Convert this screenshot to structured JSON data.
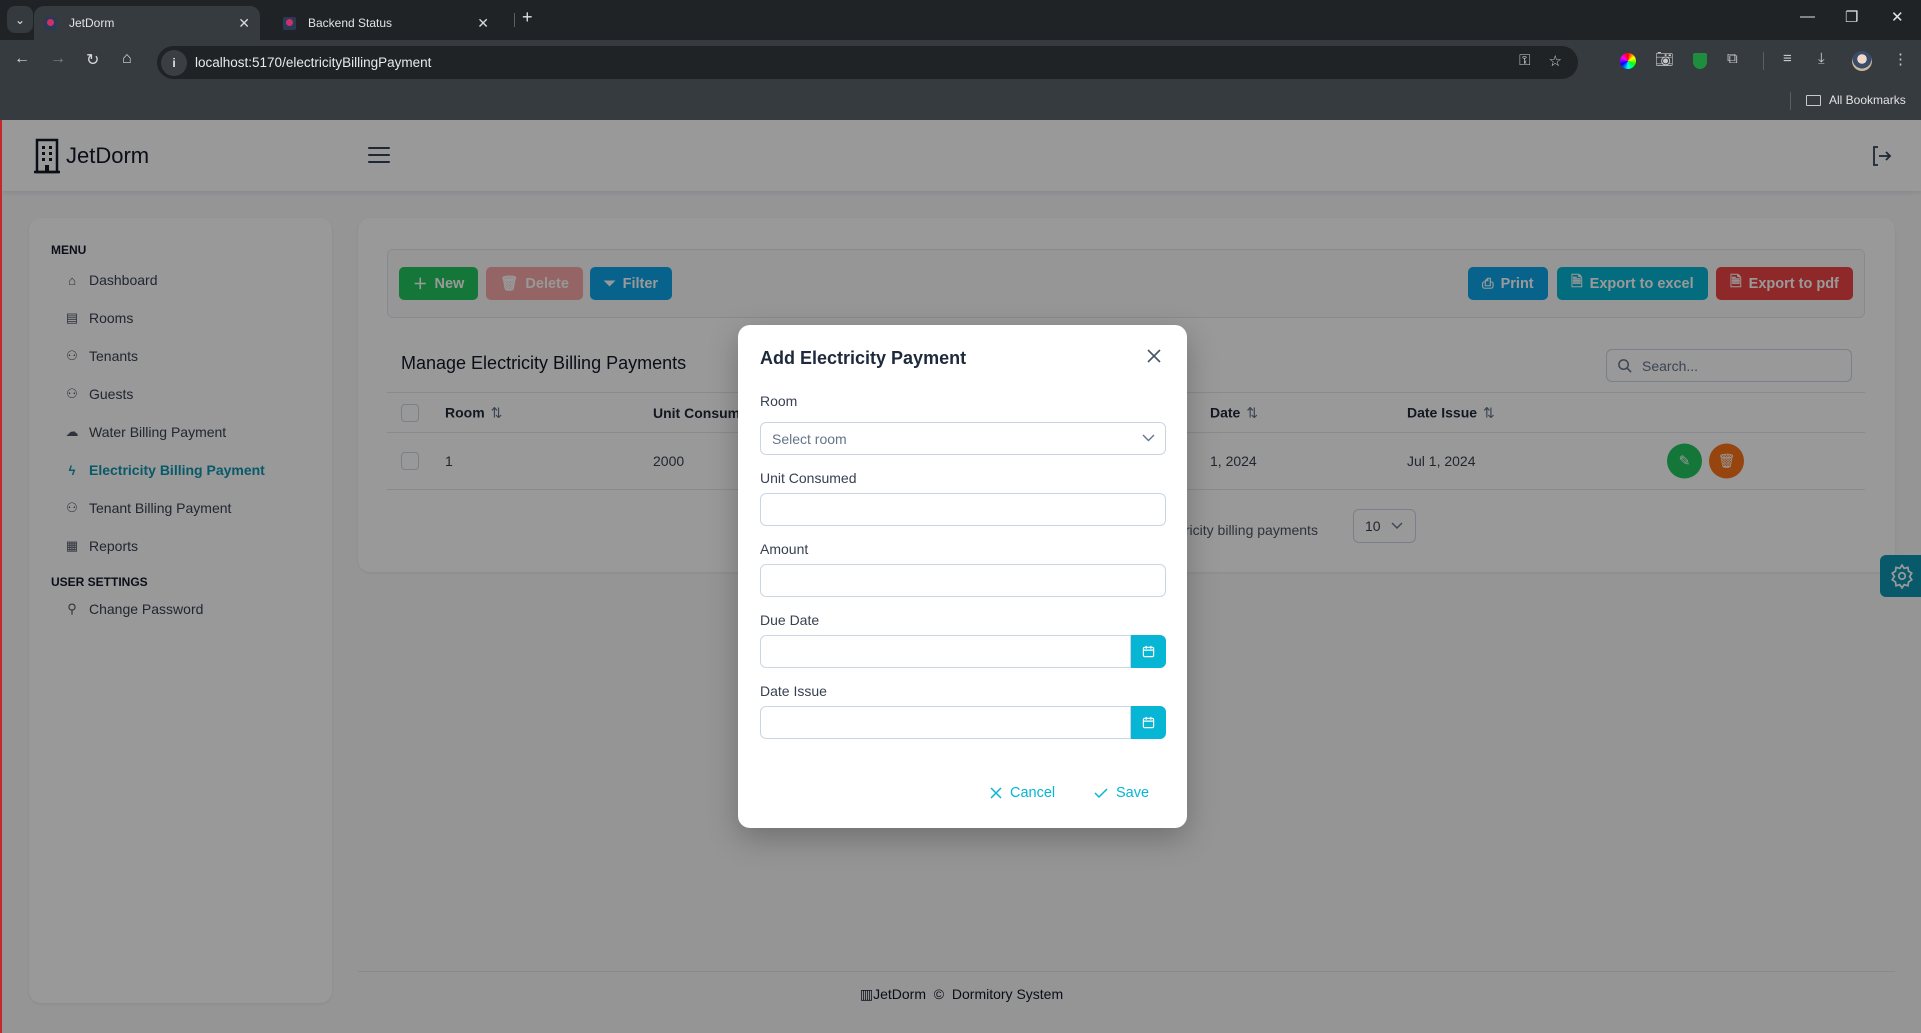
{
  "browser": {
    "tabs": [
      {
        "title": "JetDorm",
        "active": true
      },
      {
        "title": "Backend Status",
        "active": false
      }
    ],
    "url": "localhost:5170/electricityBillingPayment",
    "bookmarks_label": "All Bookmarks"
  },
  "app": {
    "name": "JetDorm",
    "sidebar": {
      "sections": [
        {
          "title": "MENU",
          "items": [
            {
              "label": "Dashboard",
              "icon": "home-icon"
            },
            {
              "label": "Rooms",
              "icon": "building-icon"
            },
            {
              "label": "Tenants",
              "icon": "users-icon"
            },
            {
              "label": "Guests",
              "icon": "users-icon"
            },
            {
              "label": "Water Billing Payment",
              "icon": "cloud-icon"
            },
            {
              "label": "Electricity Billing Payment",
              "icon": "bolt-icon",
              "active": true
            },
            {
              "label": "Tenant Billing Payment",
              "icon": "users-icon"
            },
            {
              "label": "Reports",
              "icon": "book-icon"
            }
          ]
        },
        {
          "title": "USER SETTINGS",
          "items": [
            {
              "label": "Change Password",
              "icon": "user-edit-icon"
            }
          ]
        }
      ]
    },
    "toolbar": {
      "new_label": "New",
      "delete_label": "Delete",
      "filter_label": "Filter",
      "print_label": "Print",
      "excel_label": "Export to excel",
      "pdf_label": "Export to pdf"
    },
    "table": {
      "title": "Manage Electricity Billing Payments",
      "search_placeholder": "Search...",
      "columns": [
        "Room",
        "Unit Consum",
        "Date",
        "Date Issue"
      ],
      "rows": [
        {
          "room": "1",
          "unit_consumed": "2000",
          "due_date": "1, 2024",
          "date_issue": "Jul 1, 2024"
        }
      ],
      "pager_text": "tricity billing payments",
      "rows_per_page": "10"
    },
    "footer": {
      "name": "JetDorm",
      "copyright": "©",
      "tagline": "Dormitory System"
    },
    "colors": {
      "accent": "#0e95b0",
      "new": "#22c55e",
      "delete": "#f87171",
      "filter": "#0ea5e9",
      "excel": "#06b6d4",
      "pdf": "#ef4444",
      "edit": "#22c55e",
      "row_delete": "#f97316"
    }
  },
  "modal": {
    "title": "Add Electricity Payment",
    "fields": {
      "room_label": "Room",
      "room_placeholder": "Select room",
      "unit_label": "Unit Consumed",
      "unit_value": "",
      "amount_label": "Amount",
      "amount_value": "",
      "due_label": "Due Date",
      "due_value": "",
      "issue_label": "Date Issue",
      "issue_value": ""
    },
    "cancel_label": "Cancel",
    "save_label": "Save"
  }
}
